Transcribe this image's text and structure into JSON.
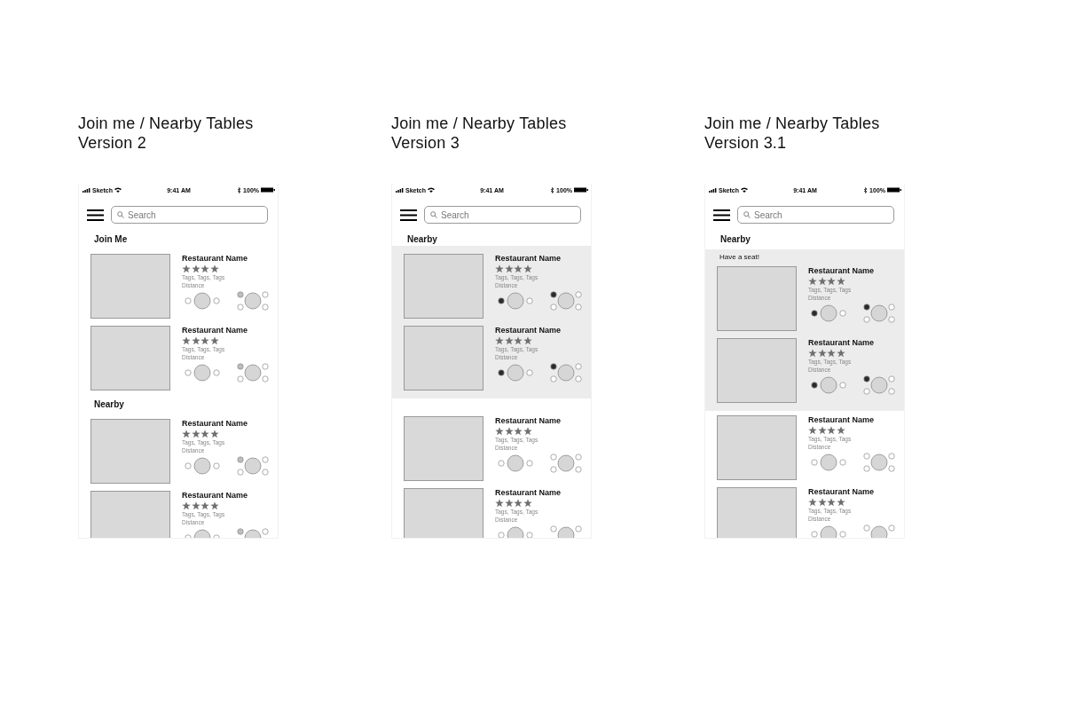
{
  "versions": [
    {
      "title": "Join me / Nearby Tables",
      "subtitle": "Version 2",
      "status_bar": {
        "carrier": "Sketch",
        "time": "9:41 AM",
        "battery": "100%"
      },
      "search": {
        "placeholder": "Search"
      },
      "sections": [
        {
          "heading": "Join Me",
          "highlighted": false,
          "cards": [
            {
              "name": "Restaurant Name",
              "stars": 4,
              "tags": "Tags, Tags, Tags",
              "distance": "Distance",
              "tables": [
                {
                  "kind": "two",
                  "seats": [
                    {
                      "taken": false
                    },
                    {
                      "taken": false
                    }
                  ]
                },
                {
                  "kind": "four",
                  "seats": [
                    {
                      "taken": true,
                      "color": "#bdbdbd"
                    },
                    {
                      "taken": false
                    },
                    {
                      "taken": false
                    },
                    {
                      "taken": false
                    }
                  ]
                }
              ]
            },
            {
              "name": "Restaurant Name",
              "stars": 4,
              "tags": "Tags, Tags, Tags",
              "distance": "Distance",
              "tables": [
                {
                  "kind": "two",
                  "seats": [
                    {
                      "taken": false
                    },
                    {
                      "taken": false
                    }
                  ]
                },
                {
                  "kind": "four",
                  "seats": [
                    {
                      "taken": true,
                      "color": "#bdbdbd"
                    },
                    {
                      "taken": false
                    },
                    {
                      "taken": false
                    },
                    {
                      "taken": false
                    }
                  ]
                }
              ]
            }
          ]
        },
        {
          "heading": "Nearby",
          "highlighted": false,
          "cards": [
            {
              "name": "Restaurant Name",
              "stars": 4,
              "tags": "Tags, Tags, Tags",
              "distance": "Distance",
              "tables": [
                {
                  "kind": "two",
                  "seats": [
                    {
                      "taken": false
                    },
                    {
                      "taken": false
                    }
                  ]
                },
                {
                  "kind": "four",
                  "seats": [
                    {
                      "taken": true,
                      "color": "#bdbdbd"
                    },
                    {
                      "taken": false
                    },
                    {
                      "taken": false
                    },
                    {
                      "taken": false
                    }
                  ]
                }
              ]
            },
            {
              "name": "Restaurant Name",
              "stars": 4,
              "tags": "Tags, Tags, Tags",
              "distance": "Distance",
              "tables": [
                {
                  "kind": "two",
                  "seats": [
                    {
                      "taken": false
                    },
                    {
                      "taken": false
                    }
                  ]
                },
                {
                  "kind": "four",
                  "seats": [
                    {
                      "taken": true,
                      "color": "#bdbdbd"
                    },
                    {
                      "taken": false
                    }
                  ]
                }
              ]
            }
          ]
        }
      ]
    },
    {
      "title": "Join me / Nearby Tables",
      "subtitle": "Version 3",
      "status_bar": {
        "carrier": "Sketch",
        "time": "9:41 AM",
        "battery": "100%"
      },
      "search": {
        "placeholder": "Search"
      },
      "sections": [
        {
          "heading": "Nearby",
          "highlighted": true,
          "cards": [
            {
              "name": "Restaurant Name",
              "stars": 4,
              "tags": "Tags, Tags, Tags",
              "distance": "Distance",
              "tables": [
                {
                  "kind": "two",
                  "seats": [
                    {
                      "taken": true,
                      "color": "#2b2b2b"
                    },
                    {
                      "taken": false
                    }
                  ]
                },
                {
                  "kind": "four",
                  "seats": [
                    {
                      "taken": true,
                      "color": "#2b2b2b"
                    },
                    {
                      "taken": false
                    },
                    {
                      "taken": false
                    },
                    {
                      "taken": false
                    }
                  ]
                }
              ]
            },
            {
              "name": "Restaurant Name",
              "stars": 4,
              "tags": "Tags, Tags, Tags",
              "distance": "Distance",
              "tables": [
                {
                  "kind": "two",
                  "seats": [
                    {
                      "taken": true,
                      "color": "#2b2b2b"
                    },
                    {
                      "taken": false
                    }
                  ]
                },
                {
                  "kind": "four",
                  "seats": [
                    {
                      "taken": true,
                      "color": "#2b2b2b"
                    },
                    {
                      "taken": false
                    },
                    {
                      "taken": false
                    },
                    {
                      "taken": false
                    }
                  ]
                }
              ]
            }
          ]
        },
        {
          "highlighted": false,
          "cards": [
            {
              "name": "Restaurant Name",
              "stars": 4,
              "tags": "Tags, Tags, Tags",
              "distance": "Distance",
              "tables": [
                {
                  "kind": "two",
                  "seats": [
                    {
                      "taken": false
                    },
                    {
                      "taken": false
                    }
                  ]
                },
                {
                  "kind": "four",
                  "seats": [
                    {
                      "taken": false
                    },
                    {
                      "taken": false
                    },
                    {
                      "taken": false
                    },
                    {
                      "taken": false
                    }
                  ]
                }
              ]
            },
            {
              "name": "Restaurant Name",
              "stars": 4,
              "tags": "Tags, Tags, Tags",
              "distance": "Distance",
              "tables": [
                {
                  "kind": "two",
                  "seats": [
                    {
                      "taken": false
                    },
                    {
                      "taken": false
                    }
                  ]
                },
                {
                  "kind": "four",
                  "seats": [
                    {
                      "taken": false
                    },
                    {
                      "taken": false
                    }
                  ]
                }
              ]
            }
          ]
        }
      ]
    },
    {
      "title": "Join me / Nearby Tables",
      "subtitle": "Version 3.1",
      "status_bar": {
        "carrier": "Sketch",
        "time": "9:41 AM",
        "battery": "100%"
      },
      "search": {
        "placeholder": "Search"
      },
      "sections": [
        {
          "heading": "Nearby",
          "highlighted": true,
          "label": "Have a seat!",
          "cards": [
            {
              "name": "Restaurant Name",
              "stars": 4,
              "tags": "Tags, Tags, Tags",
              "distance": "Distance",
              "tables": [
                {
                  "kind": "two",
                  "seats": [
                    {
                      "taken": true,
                      "color": "#2b2b2b"
                    },
                    {
                      "taken": false
                    }
                  ]
                },
                {
                  "kind": "four",
                  "seats": [
                    {
                      "taken": true,
                      "color": "#2b2b2b"
                    },
                    {
                      "taken": false
                    },
                    {
                      "taken": false
                    },
                    {
                      "taken": false
                    }
                  ]
                }
              ]
            },
            {
              "name": "Restaurant Name",
              "stars": 4,
              "tags": "Tags, Tags, Tags",
              "distance": "Distance",
              "tables": [
                {
                  "kind": "two",
                  "seats": [
                    {
                      "taken": true,
                      "color": "#2b2b2b"
                    },
                    {
                      "taken": false
                    }
                  ]
                },
                {
                  "kind": "four",
                  "seats": [
                    {
                      "taken": true,
                      "color": "#2b2b2b"
                    },
                    {
                      "taken": false
                    },
                    {
                      "taken": false
                    },
                    {
                      "taken": false
                    }
                  ]
                }
              ]
            }
          ]
        },
        {
          "highlighted": false,
          "cards": [
            {
              "name": "Restaurant Name",
              "stars": 4,
              "tags": "Tags, Tags, Tags",
              "distance": "Distance",
              "tables": [
                {
                  "kind": "two",
                  "seats": [
                    {
                      "taken": false
                    },
                    {
                      "taken": false
                    }
                  ]
                },
                {
                  "kind": "four",
                  "seats": [
                    {
                      "taken": false
                    },
                    {
                      "taken": false
                    },
                    {
                      "taken": false
                    },
                    {
                      "taken": false
                    }
                  ]
                }
              ]
            },
            {
              "name": "Restaurant Name",
              "stars": 4,
              "tags": "Tags, Tags, Tags",
              "distance": "Distance",
              "tables": [
                {
                  "kind": "two",
                  "seats": [
                    {
                      "taken": false
                    },
                    {
                      "taken": false
                    }
                  ]
                },
                {
                  "kind": "four",
                  "seats": [
                    {
                      "taken": false
                    },
                    {
                      "taken": false
                    }
                  ]
                }
              ]
            }
          ]
        }
      ]
    }
  ]
}
